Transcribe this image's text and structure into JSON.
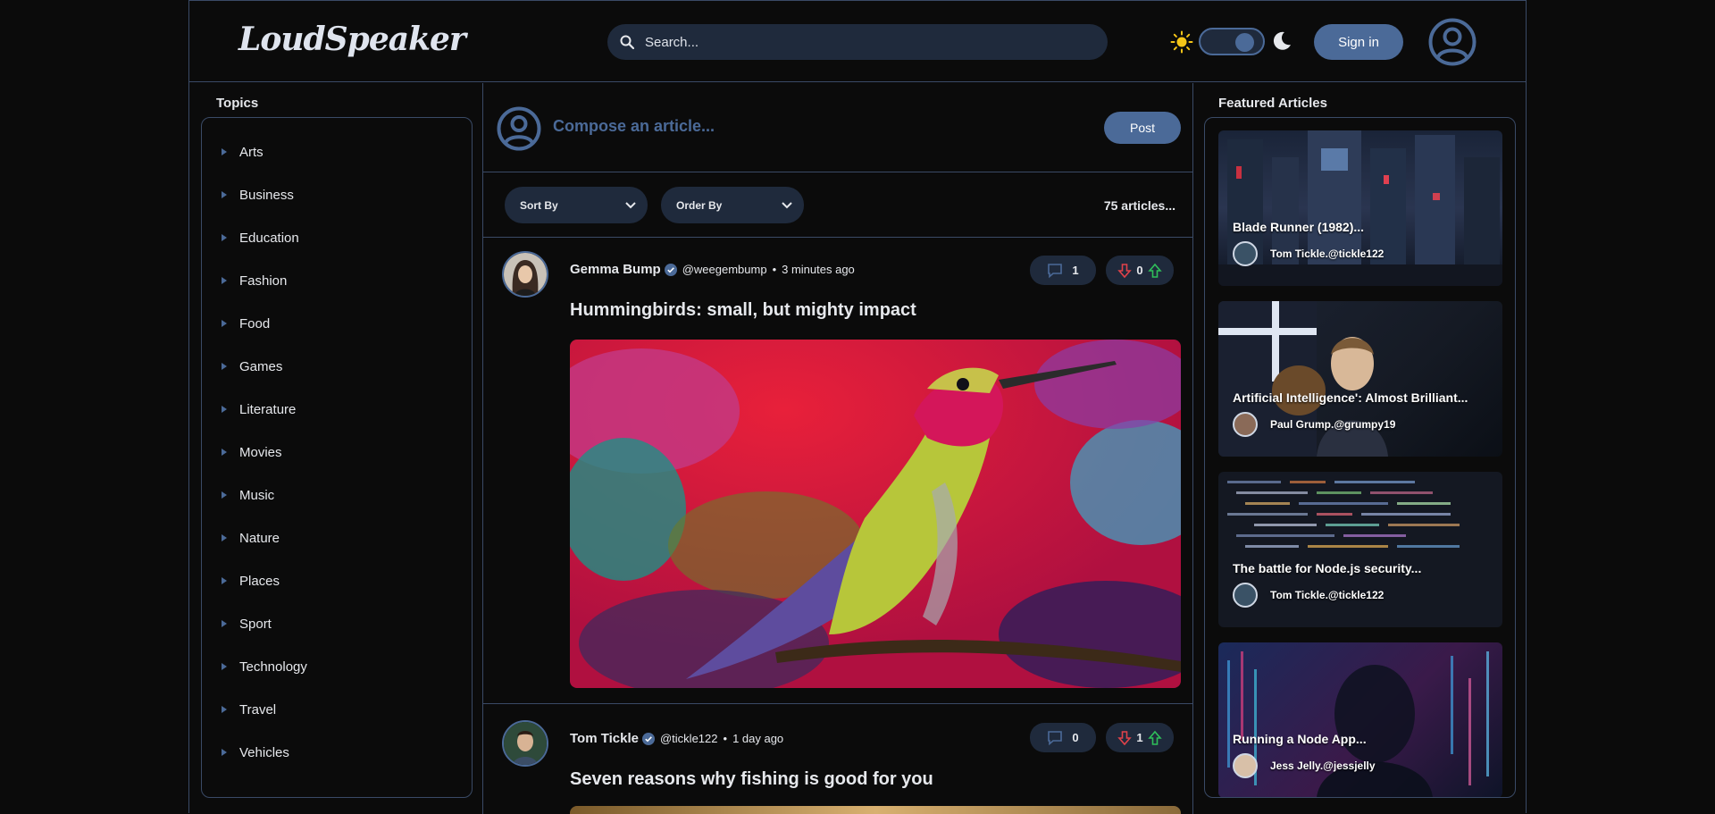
{
  "brand": {
    "logo": "LoudSpeaker"
  },
  "header": {
    "search_placeholder": "Search...",
    "signin_label": "Sign in",
    "theme_icons": [
      "sun-icon",
      "moon-icon"
    ]
  },
  "colors": {
    "accent": "#4b6a98",
    "surface": "#1f2a3c",
    "background": "#0b0b0b",
    "border": "#3a4a66"
  },
  "topics": {
    "title": "Topics",
    "items": [
      "Arts",
      "Business",
      "Education",
      "Fashion",
      "Food",
      "Games",
      "Literature",
      "Movies",
      "Music",
      "Nature",
      "Places",
      "Sport",
      "Technology",
      "Travel",
      "Vehicles"
    ]
  },
  "compose": {
    "prompt": "Compose an article...",
    "post_label": "Post"
  },
  "filters": {
    "sort_label": "Sort By",
    "order_label": "Order By",
    "count": "75 articles..."
  },
  "articles": [
    {
      "author": "Gemma Bump",
      "handle": "@weegembump",
      "time": "3 minutes ago",
      "comments": "1",
      "votes": "0",
      "title": "Hummingbirds: small, but mighty impact"
    },
    {
      "author": "Tom Tickle",
      "handle": "@tickle122",
      "time": "1 day ago",
      "comments": "0",
      "votes": "1",
      "title": "Seven reasons why fishing is good for you"
    }
  ],
  "featured": {
    "title": "Featured Articles",
    "items": [
      {
        "title": "Blade Runner (1982)...",
        "author": "Tom Tickle.@tickle122"
      },
      {
        "title": "Artificial Intelligence': Almost Brilliant...",
        "author": "Paul Grump.@grumpy19"
      },
      {
        "title": "The battle for Node.js security...",
        "author": "Tom Tickle.@tickle122"
      },
      {
        "title": "Running a Node App...",
        "author": "Jess Jelly.@jessjelly"
      }
    ]
  }
}
